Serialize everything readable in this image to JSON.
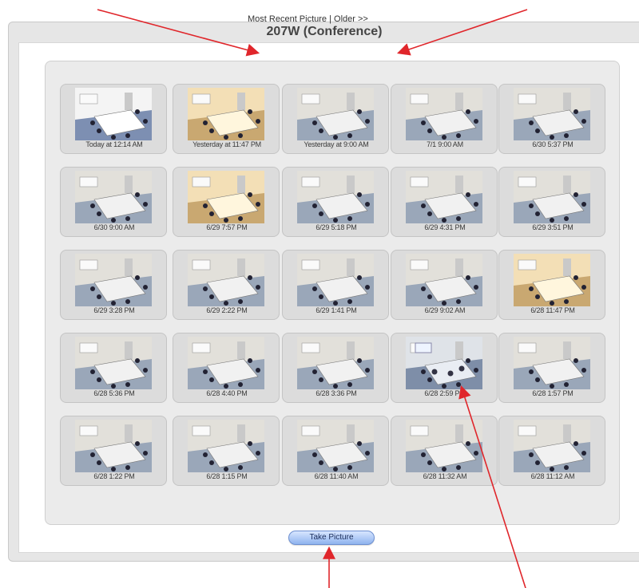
{
  "window": {
    "title": "207W (Conference)"
  },
  "nav": {
    "most_recent": "Most Recent Picture",
    "separator": "|",
    "older": "Older >>"
  },
  "thumbnails": [
    {
      "caption": "Today at 12:14 AM",
      "tone": "bright"
    },
    {
      "caption": "Yesterday at 11:47 PM",
      "tone": "warm"
    },
    {
      "caption": "Yesterday at 9:00 AM",
      "tone": "normal"
    },
    {
      "caption": "7/1 9:00 AM",
      "tone": "normal"
    },
    {
      "caption": "6/30 5:37 PM",
      "tone": "normal"
    },
    {
      "caption": "6/30 9:00 AM",
      "tone": "normal"
    },
    {
      "caption": "6/29 7:57 PM",
      "tone": "warm"
    },
    {
      "caption": "6/29 5:18 PM",
      "tone": "normal"
    },
    {
      "caption": "6/29 4:31 PM",
      "tone": "normal"
    },
    {
      "caption": "6/29 3:51 PM",
      "tone": "normal"
    },
    {
      "caption": "6/29 3:28 PM",
      "tone": "normal"
    },
    {
      "caption": "6/29 2:22 PM",
      "tone": "normal"
    },
    {
      "caption": "6/29 1:41 PM",
      "tone": "normal"
    },
    {
      "caption": "6/29 9:02 AM",
      "tone": "normal"
    },
    {
      "caption": "6/28 11:47 PM",
      "tone": "warm"
    },
    {
      "caption": "6/28 5:36 PM",
      "tone": "normal"
    },
    {
      "caption": "6/28 4:40 PM",
      "tone": "normal"
    },
    {
      "caption": "6/28 3:36 PM",
      "tone": "normal"
    },
    {
      "caption": "6/28 2:59 PM",
      "tone": "meeting"
    },
    {
      "caption": "6/28 1:57 PM",
      "tone": "normal"
    },
    {
      "caption": "6/28 1:22 PM",
      "tone": "normal"
    },
    {
      "caption": "6/28 1:15 PM",
      "tone": "normal"
    },
    {
      "caption": "6/28 11:40 AM",
      "tone": "normal"
    },
    {
      "caption": "6/28 11:32 AM",
      "tone": "normal"
    },
    {
      "caption": "6/28 11:12 AM",
      "tone": "normal"
    }
  ],
  "take_picture": {
    "label": "Take Picture"
  },
  "colors": {
    "annotation_arrow": "#e0262b",
    "button": "#8fb3ee"
  }
}
